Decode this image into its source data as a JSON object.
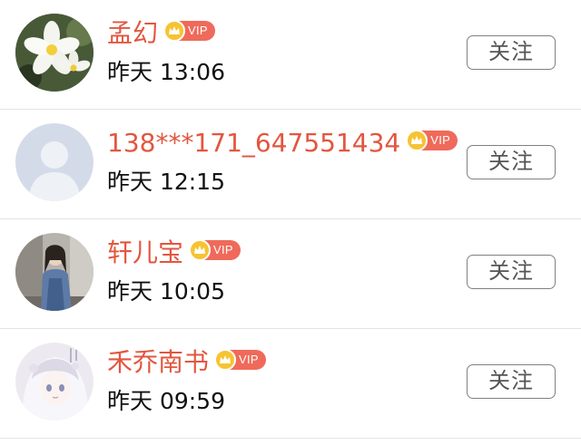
{
  "users": [
    {
      "name": "孟幻",
      "vip": "VIP",
      "time": "昨天 13:06",
      "follow": "关注",
      "avatar": "plumeria-flower-photo"
    },
    {
      "name": "138***171_647551434",
      "vip": "VIP",
      "time": "昨天 12:15",
      "follow": "关注",
      "avatar": "default-user-silhouette"
    },
    {
      "name": "轩儿宝",
      "vip": "VIP",
      "time": "昨天 10:05",
      "follow": "关注",
      "avatar": "girl-denim-jacket-photo"
    },
    {
      "name": "禾乔南书",
      "vip": "VIP",
      "time": "昨天 09:59",
      "follow": "关注",
      "avatar": "anime-girl-illustration"
    }
  ],
  "colors": {
    "name": "#e2563f",
    "vip_badge": "#ef6a5a",
    "crown": "#f6c431",
    "divider": "#e4e4e4"
  }
}
